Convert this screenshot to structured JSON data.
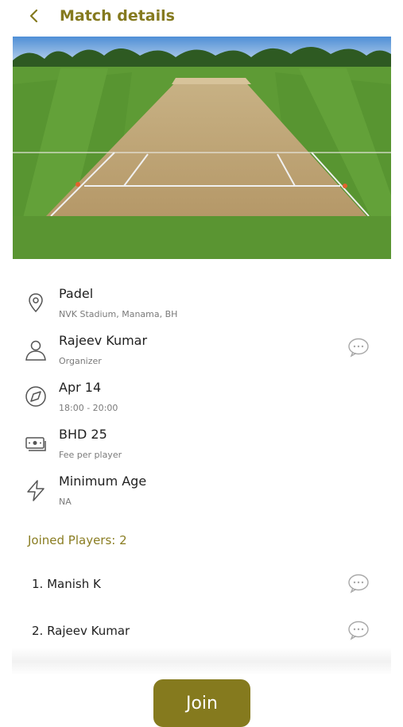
{
  "header": {
    "title": "Match details",
    "back_icon": "chevron-left-icon"
  },
  "hero": {
    "image": "cricket-pitch-photo"
  },
  "details": [
    {
      "icon": "location-pin-icon",
      "title": "Padel",
      "subtitle": "NVK Stadium, Manama, BH",
      "chat": false
    },
    {
      "icon": "user-icon",
      "title": "Rajeev Kumar",
      "subtitle": "Organizer",
      "chat": true
    },
    {
      "icon": "compass-icon",
      "title": "Apr 14",
      "subtitle": "18:00 - 20:00",
      "chat": false
    },
    {
      "icon": "cash-icon",
      "title": "BHD 25",
      "subtitle": "Fee per player",
      "chat": false
    },
    {
      "icon": "lightning-icon",
      "title": "Minimum Age",
      "subtitle": "NA",
      "chat": false
    }
  ],
  "players": {
    "heading": "Joined Players: 2",
    "list": [
      {
        "name": "1. Manish K"
      },
      {
        "name": "2. Rajeev Kumar"
      }
    ]
  },
  "actions": {
    "join_label": "Join"
  },
  "colors": {
    "accent": "#857a1e",
    "icon_gray": "#555555",
    "chat_gray": "#a8a8a8"
  }
}
